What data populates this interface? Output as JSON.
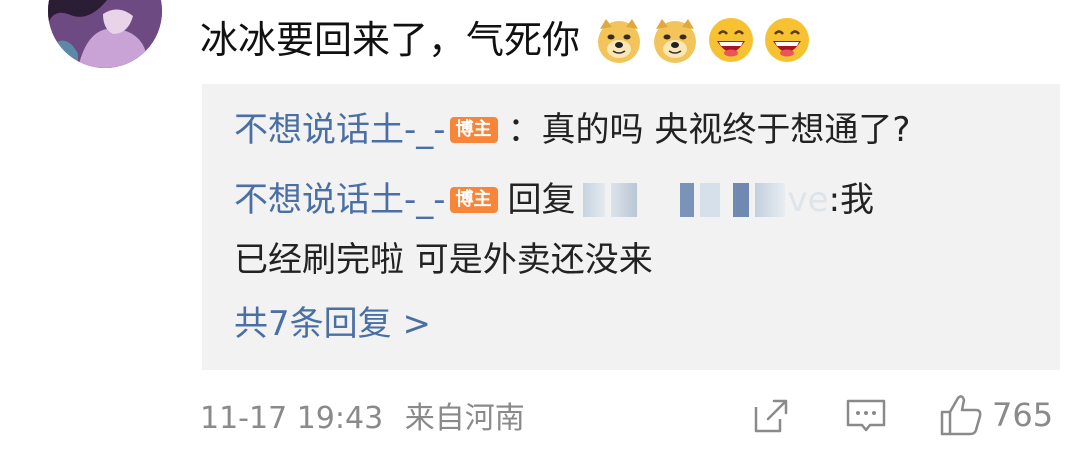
{
  "comment": {
    "text": "冰冰要回来了，气死你",
    "emojis": [
      "doge-icon",
      "doge-icon",
      "laugh-icon",
      "laugh-icon"
    ]
  },
  "replies": [
    {
      "user": "不想说话土-_-",
      "badge": "博主",
      "separator": "：",
      "text": "真的吗 央视终于想通了?"
    },
    {
      "user": "不想说话土-_-",
      "badge": "博主",
      "prefix": "回复",
      "mention_tail": "ve",
      "text_after": ":我",
      "text_line2": "已经刷完啦 可是外卖还没来"
    }
  ],
  "more_replies": "共7条回复 >",
  "footer": {
    "timestamp": "11-17 19:43",
    "source": "来自河南",
    "likes": "765"
  },
  "colors": {
    "link": "#4a6fa5",
    "badge": "#f7863b",
    "reply_bg": "#f2f2f2",
    "meta": "#8a8a8a"
  }
}
